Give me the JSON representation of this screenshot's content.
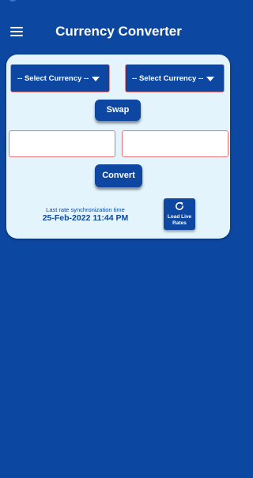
{
  "app": {
    "title": "Currency Converter"
  },
  "appbar": {
    "menu_icon": "hamburger-menu-icon"
  },
  "colors": {
    "primary": "#0c47a1",
    "card": "#e3f4fd",
    "input_border": "#e57373",
    "on_primary": "#ffffff"
  },
  "converter": {
    "from_currency": {
      "selected": "-- Select Currency --"
    },
    "to_currency": {
      "selected": "-- Select Currency --"
    },
    "swap_label": "Swap",
    "amount_from": {
      "value": "",
      "placeholder": ""
    },
    "amount_to": {
      "value": "",
      "placeholder": ""
    },
    "convert_label": "Convert"
  },
  "sync": {
    "label": "Last rate synchronization time",
    "time": "25-Feb-2022 11:44 PM",
    "refresh_icon": "refresh-icon",
    "button_label": "Load Live\nRates"
  }
}
